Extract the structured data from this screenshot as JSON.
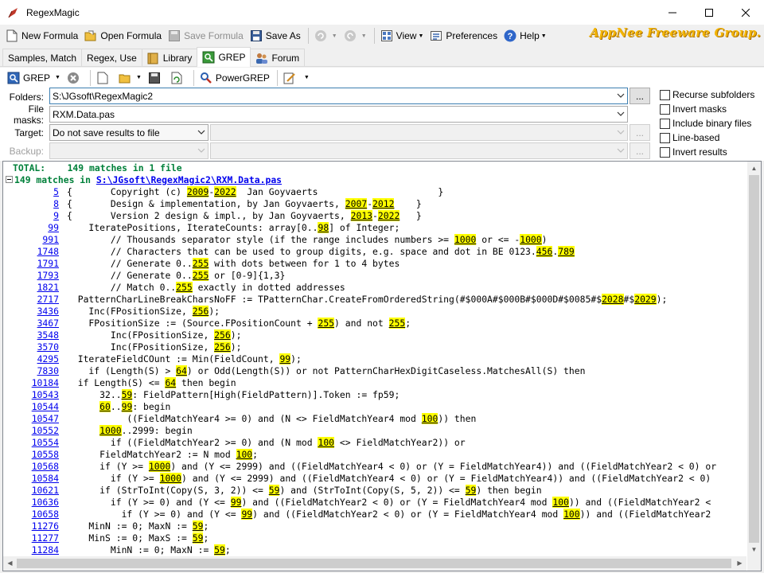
{
  "window": {
    "title": "RegexMagic"
  },
  "toolbar": {
    "new_formula": "New Formula",
    "open_formula": "Open Formula",
    "save_formula": "Save Formula",
    "save_as": "Save As",
    "view": "View",
    "preferences": "Preferences",
    "help": "Help",
    "brand": "AppNee Freeware Group."
  },
  "tabs": [
    {
      "label": "Samples, Match"
    },
    {
      "label": "Regex, Use"
    },
    {
      "label": "Library"
    },
    {
      "label": "GREP"
    },
    {
      "label": "Forum"
    }
  ],
  "grep_toolbar": {
    "grep": "GREP",
    "powergrep": "PowerGREP"
  },
  "form": {
    "folders_label": "Folders:",
    "folders_value": "S:\\JGsoft\\RegexMagic2",
    "filemasks_label": "File masks:",
    "filemasks_value": "RXM.Data.pas",
    "target_label": "Target:",
    "target_value": "Do not save results to file",
    "backup_label": "Backup:",
    "browse": "...",
    "checks": [
      {
        "label": "Recurse subfolders"
      },
      {
        "label": "Invert masks"
      },
      {
        "label": "Include binary files"
      },
      {
        "label": "Line-based"
      },
      {
        "label": "Invert results"
      }
    ]
  },
  "results": {
    "total": "TOTAL:    149 matches in 1 file",
    "file_prefix": "149 matches in ",
    "file_path": "S:\\JGsoft\\RegexMagic2\\RXM.Data.pas",
    "lines": [
      {
        "n": "5",
        "s": [
          "{       Copyright (c) ",
          "2009",
          "-",
          "2022",
          "  Jan Goyvaerts                      }"
        ]
      },
      {
        "n": "8",
        "s": [
          "{       Design & implementation, by Jan Goyvaerts, ",
          "2007",
          "-",
          "2012",
          "    }"
        ]
      },
      {
        "n": "9",
        "s": [
          "{       Version 2 design & impl., by Jan Goyvaerts, ",
          "2013",
          "-",
          "2022",
          "   }"
        ]
      },
      {
        "n": "99",
        "s": [
          "    IterateP​ositions, IterateCounts: array[0..",
          "98",
          "] of Integer;"
        ]
      },
      {
        "n": "991",
        "s": [
          "        // Thousands separator style (if the range includes numbers >= ",
          "1000",
          " or <= -",
          "1000",
          ")"
        ]
      },
      {
        "n": "1748",
        "s": [
          "        // Characters that can be used to group digits, e.g. space and dot in BE 0123.",
          "456",
          ".",
          "789"
        ]
      },
      {
        "n": "1791",
        "s": [
          "        // Generate 0..",
          "255",
          " with dots between for 1 to 4 bytes"
        ]
      },
      {
        "n": "1793",
        "s": [
          "        // Generate 0..",
          "255",
          " or [0-9]{1,3}"
        ]
      },
      {
        "n": "1821",
        "s": [
          "        // Match 0..",
          "255",
          " exactly in dotted addresses"
        ]
      },
      {
        "n": "2717",
        "s": [
          "  PatternCharLineBreakCharsNoFF := TPatternChar.CreateFromOrderedString(#$000A#$000B#$000D#$0085#$",
          "2028",
          "#$",
          "2029",
          ");"
        ]
      },
      {
        "n": "3436",
        "s": [
          "    Inc(FPositionSize, ",
          "256",
          ");"
        ]
      },
      {
        "n": "3467",
        "s": [
          "    FPositionSize := (Source.FPositionCount + ",
          "255",
          ") and not ",
          "255",
          ";"
        ]
      },
      {
        "n": "3548",
        "s": [
          "        Inc(FPositionSize, ",
          "256",
          ");"
        ]
      },
      {
        "n": "3570",
        "s": [
          "        Inc(FPositionSize, ",
          "256",
          ");"
        ]
      },
      {
        "n": "4295",
        "s": [
          "  IterateFieldCOunt := Min(FieldCount, ",
          "99",
          ");"
        ]
      },
      {
        "n": "7830",
        "s": [
          "    if (Length(S) > ",
          "64",
          ") or Odd(Length(S)) or not PatternCharHexDigitCaseless.MatchesAll(S) then"
        ]
      },
      {
        "n": "10184",
        "s": [
          "  if Length(S) <= ",
          "64",
          " then begin"
        ]
      },
      {
        "n": "10543",
        "s": [
          "      32..",
          "59",
          ": FieldPattern[High(FieldPattern)].Token := fp59;"
        ]
      },
      {
        "n": "10544",
        "s": [
          "      ",
          "60",
          "..",
          "99",
          ": begin"
        ]
      },
      {
        "n": "10547",
        "s": [
          "           ((FieldMatchYear4 >= 0) and (N <> FieldMatchYear4 mod ",
          "100",
          ")) then"
        ]
      },
      {
        "n": "10552",
        "s": [
          "      ",
          "1000",
          "..2999: begin"
        ]
      },
      {
        "n": "10554",
        "s": [
          "        if ((FieldMatchYear2 >= 0) and (N mod ",
          "100",
          " <> FieldMatchYear2)) or"
        ]
      },
      {
        "n": "10558",
        "s": [
          "      FieldMatchYear2 := N mod ",
          "100",
          ";"
        ]
      },
      {
        "n": "10568",
        "s": [
          "      if (Y >= ",
          "1000",
          ") and (Y <= 2999) and ((FieldMatchYear4 < 0) or (Y = FieldMatchYear4)) and ((FieldMatchYear2 < 0) or"
        ]
      },
      {
        "n": "10584",
        "s": [
          "        if (Y >= ",
          "1000",
          ") and (Y <= 2999) and ((FieldMatchYear4 < 0) or (Y = FieldMatchYear4)) and ((FieldMatchYear2 < 0)"
        ]
      },
      {
        "n": "10621",
        "s": [
          "      if (StrToInt(Copy(S, 3, 2)) <= ",
          "59",
          ") and (StrToInt(Copy(S, 5, 2)) <= ",
          "59",
          ") then begin"
        ]
      },
      {
        "n": "10636",
        "s": [
          "        if (Y >= 0) and (Y <= ",
          "99",
          ") and ((FieldMatchYear2 < 0) or (Y = FieldMatchYear4 mod ",
          "100",
          ")) and ((FieldMatchYear2 <"
        ]
      },
      {
        "n": "10658",
        "s": [
          "          if (Y >= 0) and (Y <= ",
          "99",
          ") and ((FieldMatchYear2 < 0) or (Y = FieldMatchYear4 mod ",
          "100",
          ")) and ((FieldMatchYear2"
        ]
      },
      {
        "n": "11276",
        "s": [
          "    MinN := 0; MaxN := ",
          "59",
          ";"
        ]
      },
      {
        "n": "11277",
        "s": [
          "    MinS := 0; MaxS := ",
          "59",
          ";"
        ]
      },
      {
        "n": "11284",
        "s": [
          "        MinN := 0; MaxN := ",
          "59",
          ";"
        ]
      }
    ]
  }
}
